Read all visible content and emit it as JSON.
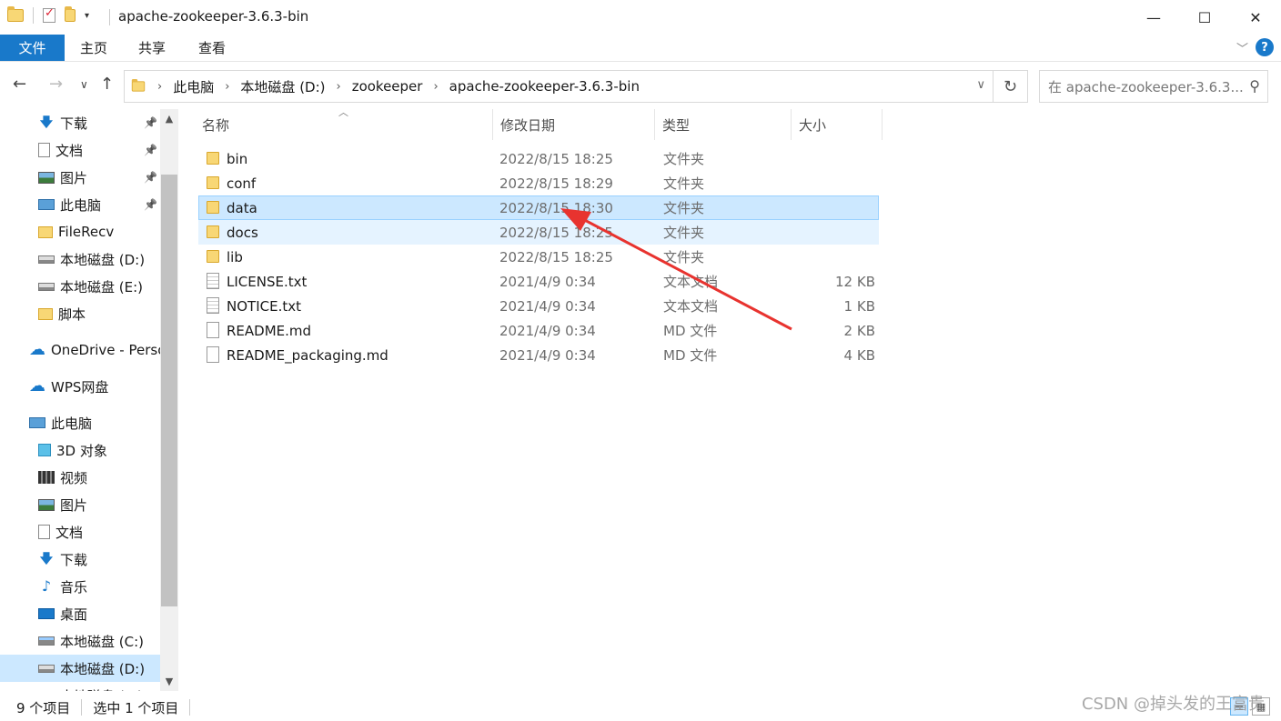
{
  "window": {
    "title": "apache-zookeeper-3.6.3-bin",
    "minimize": "—",
    "maximize": "☐",
    "close": "✕"
  },
  "ribbon": {
    "file_tab": "文件",
    "tabs": [
      "主页",
      "共享",
      "查看"
    ]
  },
  "address": {
    "crumbs": [
      "此电脑",
      "本地磁盘 (D:)",
      "zookeeper",
      "apache-zookeeper-3.6.3-bin"
    ],
    "search_placeholder": "在 apache-zookeeper-3.6.3..."
  },
  "sidebar": {
    "items": [
      {
        "label": "下载",
        "icon": "download-icon",
        "pinned": true
      },
      {
        "label": "文档",
        "icon": "document-icon",
        "pinned": true
      },
      {
        "label": "图片",
        "icon": "picture-icon",
        "pinned": true
      },
      {
        "label": "此电脑",
        "icon": "computer-icon",
        "pinned": true
      },
      {
        "label": "FileRecv",
        "icon": "folder-icon",
        "pinned": false
      },
      {
        "label": "本地磁盘 (D:)",
        "icon": "drive-icon",
        "pinned": false
      },
      {
        "label": "本地磁盘 (E:)",
        "icon": "drive-icon",
        "pinned": false
      },
      {
        "label": "脚本",
        "icon": "folder-icon",
        "pinned": false
      },
      {
        "label": "OneDrive - Perso",
        "icon": "cloud-icon",
        "pinned": false
      },
      {
        "label": "WPS网盘",
        "icon": "cloud-icon",
        "pinned": false
      },
      {
        "label": "此电脑",
        "icon": "computer-icon",
        "pinned": false
      },
      {
        "label": "3D 对象",
        "icon": "3d-objects-icon",
        "pinned": false
      },
      {
        "label": "视频",
        "icon": "video-icon",
        "pinned": false
      },
      {
        "label": "图片",
        "icon": "picture-icon",
        "pinned": false
      },
      {
        "label": "文档",
        "icon": "document-icon",
        "pinned": false
      },
      {
        "label": "下载",
        "icon": "download-icon",
        "pinned": false
      },
      {
        "label": "音乐",
        "icon": "music-icon",
        "pinned": false
      },
      {
        "label": "桌面",
        "icon": "desktop-icon",
        "pinned": false
      },
      {
        "label": "本地磁盘 (C:)",
        "icon": "drive-icon",
        "pinned": false
      },
      {
        "label": "本地磁盘 (D:)",
        "icon": "drive-icon",
        "pinned": false,
        "selected": true
      },
      {
        "label": "本地磁盘 (E:)",
        "icon": "drive-icon",
        "pinned": false
      }
    ]
  },
  "columns": {
    "name": "名称",
    "date": "修改日期",
    "type": "类型",
    "size": "大小"
  },
  "files": [
    {
      "name": "bin",
      "date": "2022/8/15 18:25",
      "type": "文件夹",
      "size": "",
      "kind": "folder"
    },
    {
      "name": "conf",
      "date": "2022/8/15 18:29",
      "type": "文件夹",
      "size": "",
      "kind": "folder"
    },
    {
      "name": "data",
      "date": "2022/8/15 18:30",
      "type": "文件夹",
      "size": "",
      "kind": "folder",
      "state": "selected"
    },
    {
      "name": "docs",
      "date": "2022/8/15 18:25",
      "type": "文件夹",
      "size": "",
      "kind": "folder",
      "state": "hover"
    },
    {
      "name": "lib",
      "date": "2022/8/15 18:25",
      "type": "文件夹",
      "size": "",
      "kind": "folder"
    },
    {
      "name": "LICENSE.txt",
      "date": "2021/4/9 0:34",
      "type": "文本文档",
      "size": "12 KB",
      "kind": "txt"
    },
    {
      "name": "NOTICE.txt",
      "date": "2021/4/9 0:34",
      "type": "文本文档",
      "size": "1 KB",
      "kind": "txt"
    },
    {
      "name": "README.md",
      "date": "2021/4/9 0:34",
      "type": "MD 文件",
      "size": "2 KB",
      "kind": "doc"
    },
    {
      "name": "README_packaging.md",
      "date": "2021/4/9 0:34",
      "type": "MD 文件",
      "size": "4 KB",
      "kind": "doc"
    }
  ],
  "status": {
    "count": "9 个项目",
    "selected": "选中 1 个项目"
  },
  "watermark": "CSDN @掉头发的王富贵",
  "colors": {
    "accent": "#1979ca",
    "selection": "#cce8ff",
    "annotation_arrow": "#e8332f"
  }
}
